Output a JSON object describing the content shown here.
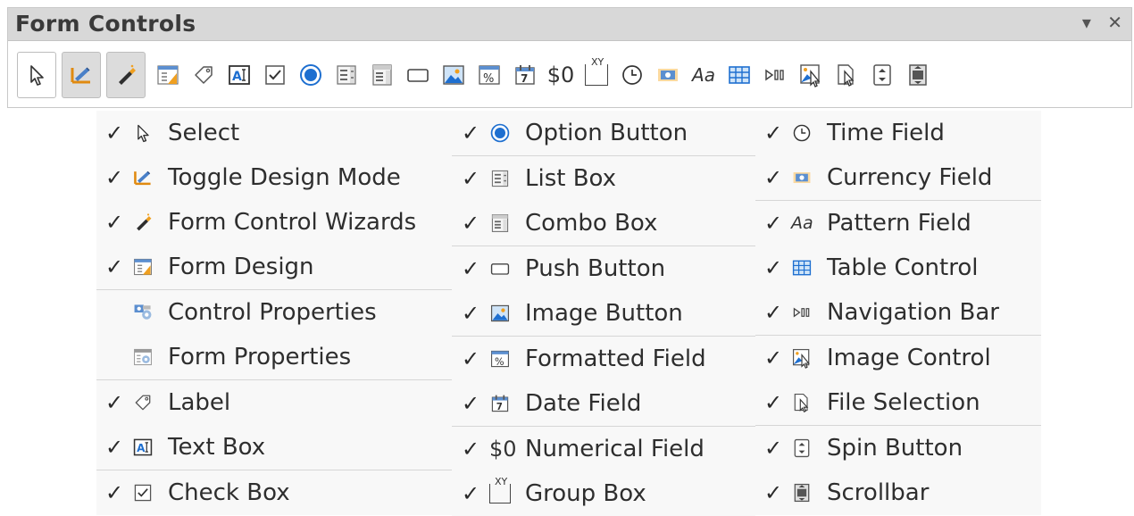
{
  "toolbar": {
    "title": "Form Controls",
    "dropdown_glyph": "▾",
    "close_glyph": "✕",
    "currency_text": "$0",
    "pattern_text": "Aa",
    "group_text": "XY"
  },
  "colors": {
    "accent_blue": "#1e6fd0",
    "accent_orange": "#f0a020",
    "panel_bg": "#f8f8f8",
    "titlebar_bg": "#d8d8d8"
  },
  "menu": {
    "column1": [
      {
        "label": "Select",
        "checked": true,
        "icon": "select-arrow-icon"
      },
      {
        "label": "Toggle Design Mode",
        "checked": true,
        "icon": "design-mode-icon"
      },
      {
        "label": "Form Control Wizards",
        "checked": true,
        "icon": "wizard-wand-icon"
      },
      {
        "label": "Form Design",
        "checked": true,
        "icon": "form-design-icon"
      },
      {
        "label": "Control Properties",
        "checked": false,
        "icon": "control-properties-icon"
      },
      {
        "label": "Form Properties",
        "checked": false,
        "icon": "form-properties-icon"
      },
      {
        "label": "Label",
        "checked": true,
        "icon": "label-tag-icon"
      },
      {
        "label": "Text Box",
        "checked": true,
        "icon": "text-box-icon"
      },
      {
        "label": "Check Box",
        "checked": true,
        "icon": "check-box-icon"
      }
    ],
    "column2": [
      {
        "label": "Option Button",
        "checked": true,
        "icon": "option-button-icon"
      },
      {
        "label": "List Box",
        "checked": true,
        "icon": "list-box-icon"
      },
      {
        "label": "Combo Box",
        "checked": true,
        "icon": "combo-box-icon"
      },
      {
        "label": "Push Button",
        "checked": true,
        "icon": "push-button-icon"
      },
      {
        "label": "Image Button",
        "checked": true,
        "icon": "image-button-icon"
      },
      {
        "label": "Formatted Field",
        "checked": true,
        "icon": "formatted-field-icon"
      },
      {
        "label": "Date Field",
        "checked": true,
        "icon": "date-field-icon"
      },
      {
        "label": "Numerical Field",
        "checked": true,
        "icon": "numerical-field-icon"
      },
      {
        "label": "Group Box",
        "checked": true,
        "icon": "group-box-icon"
      }
    ],
    "column3": [
      {
        "label": "Time Field",
        "checked": true,
        "icon": "time-field-icon"
      },
      {
        "label": "Currency Field",
        "checked": true,
        "icon": "currency-field-icon"
      },
      {
        "label": "Pattern Field",
        "checked": true,
        "icon": "pattern-field-icon"
      },
      {
        "label": "Table Control",
        "checked": true,
        "icon": "table-control-icon"
      },
      {
        "label": "Navigation Bar",
        "checked": true,
        "icon": "navigation-bar-icon"
      },
      {
        "label": "Image Control",
        "checked": true,
        "icon": "image-control-icon"
      },
      {
        "label": "File Selection",
        "checked": true,
        "icon": "file-selection-icon"
      },
      {
        "label": "Spin Button",
        "checked": true,
        "icon": "spin-button-icon"
      },
      {
        "label": "Scrollbar",
        "checked": true,
        "icon": "scrollbar-icon"
      }
    ],
    "check_glyph": "✓"
  }
}
